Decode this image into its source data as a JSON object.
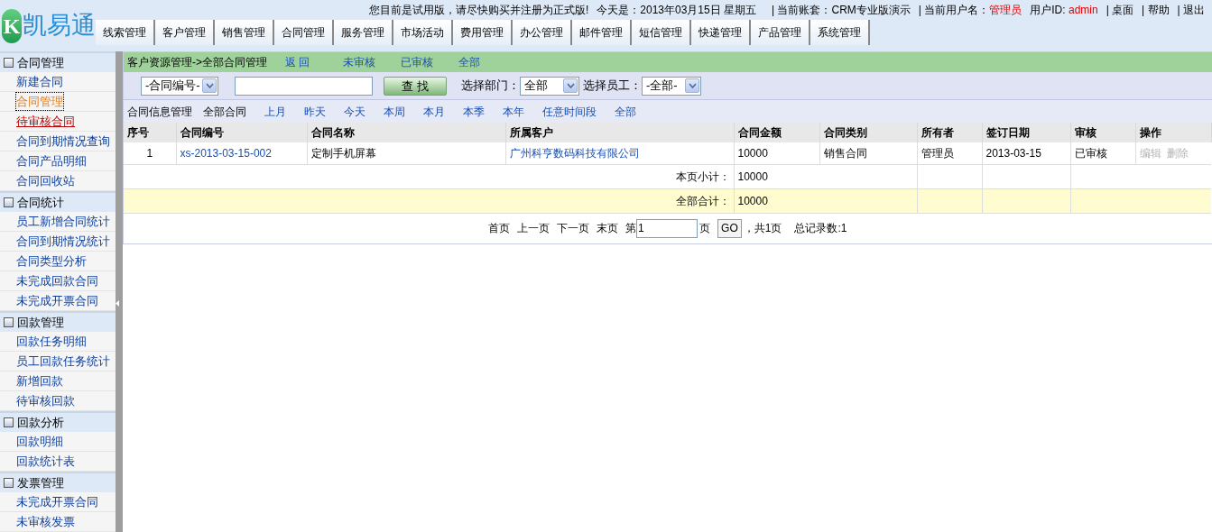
{
  "logo": {
    "letter": "K",
    "name": "凯易通"
  },
  "top_info": [
    {
      "kind": "text",
      "text": "您目前是试用版，请尽快购买并注册为正式版!"
    },
    {
      "kind": "text",
      "text": "今天是：2013年03月15日  星期五"
    },
    {
      "kind": "sep",
      "text": "| 当前账套：CRM专业版演示"
    },
    {
      "kind": "labelvalue",
      "text": "| 当前用户名：",
      "value": "管理员"
    },
    {
      "kind": "labelvalue",
      "text": "用户ID: ",
      "value": "admin"
    },
    {
      "kind": "link",
      "text": "| 桌面"
    },
    {
      "kind": "link",
      "text": "| 帮助"
    },
    {
      "kind": "link",
      "text": "| 退出"
    }
  ],
  "nav_tabs": [
    "线索管理",
    "客户管理",
    "销售管理",
    "合同管理",
    "服务管理",
    "市场活动",
    "费用管理",
    "办公管理",
    "邮件管理",
    "短信管理",
    "快递管理",
    "产品管理",
    "系统管理"
  ],
  "sidebar": [
    {
      "title": "合同管理",
      "expanded": true,
      "items": [
        {
          "label": "新建合同",
          "selected": false,
          "hovered": false
        },
        {
          "label": "合同管理",
          "selected": true,
          "hovered": false
        },
        {
          "label": "待审核合同",
          "selected": false,
          "hovered": true
        },
        {
          "label": "合同到期情况查询",
          "selected": false,
          "hovered": false
        },
        {
          "label": "合同产品明细",
          "selected": false,
          "hovered": false
        },
        {
          "label": "合同回收站",
          "selected": false,
          "hovered": false
        }
      ]
    },
    {
      "title": "合同统计",
      "expanded": true,
      "items": [
        {
          "label": "员工新增合同统计",
          "selected": false,
          "hovered": false
        },
        {
          "label": "合同到期情况统计",
          "selected": false,
          "hovered": false
        },
        {
          "label": "合同类型分析",
          "selected": false,
          "hovered": false
        },
        {
          "label": "未完成回款合同",
          "selected": false,
          "hovered": false
        },
        {
          "label": "未完成开票合同",
          "selected": false,
          "hovered": false
        }
      ]
    },
    {
      "title": "回款管理",
      "expanded": true,
      "items": [
        {
          "label": "回款任务明细",
          "selected": false,
          "hovered": false
        },
        {
          "label": "员工回款任务统计",
          "selected": false,
          "hovered": false
        },
        {
          "label": "新增回款",
          "selected": false,
          "hovered": false
        },
        {
          "label": "待审核回款",
          "selected": false,
          "hovered": false
        }
      ]
    },
    {
      "title": "回款分析",
      "expanded": true,
      "items": [
        {
          "label": "回款明细",
          "selected": false,
          "hovered": false
        },
        {
          "label": "回款统计表",
          "selected": false,
          "hovered": false
        }
      ]
    },
    {
      "title": "发票管理",
      "expanded": true,
      "items": [
        {
          "label": "未完成开票合同",
          "selected": false,
          "hovered": false
        },
        {
          "label": "未审核发票",
          "selected": false,
          "hovered": false
        }
      ]
    }
  ],
  "breadcrumb": {
    "path": "客户资源管理->全部合同管理",
    "links": [
      "返 回",
      "未审核",
      "已审核",
      "全部"
    ]
  },
  "search": {
    "field_select": "-合同编号-",
    "button": "查 找",
    "dept_label": "选择部门：",
    "dept": "全部",
    "staff_label": "选择员工：",
    "staff": "-全部-"
  },
  "period_bar": {
    "labels": [
      "合同信息管理",
      "全部合同"
    ],
    "links": [
      "上月",
      "昨天",
      "今天",
      "本周",
      "本月",
      "本季",
      "本年",
      "任意时间段",
      "全部"
    ]
  },
  "table": {
    "columns": [
      "序号",
      "合同编号",
      "合同名称",
      "所属客户",
      "合同金额",
      "合同类别",
      "所有者",
      "签订日期",
      "审核",
      "操作"
    ],
    "rows": [
      {
        "index": "1",
        "number": "xs-2013-03-15-002",
        "name": "定制手机屏幕",
        "customer": "广州科亨数码科技有限公司",
        "amount": "10000",
        "type": "销售合同",
        "owner": "管理员",
        "date": "2013-03-15",
        "review": "已审核",
        "actions": [
          {
            "label": "编辑",
            "disabled": true
          },
          {
            "label": "删除",
            "disabled": true
          }
        ]
      }
    ],
    "subtotal": {
      "label": "本页小计：",
      "value": "10000"
    },
    "total": {
      "label": "全部合计：",
      "value": "10000"
    }
  },
  "pagination": {
    "links": [
      "首页",
      "上一页",
      "下一页",
      "末页"
    ],
    "page_prefix": "第",
    "page": "1",
    "page_suffix": "页",
    "go": "GO",
    "pages": "，共1页",
    "records": "总记录数:1"
  }
}
